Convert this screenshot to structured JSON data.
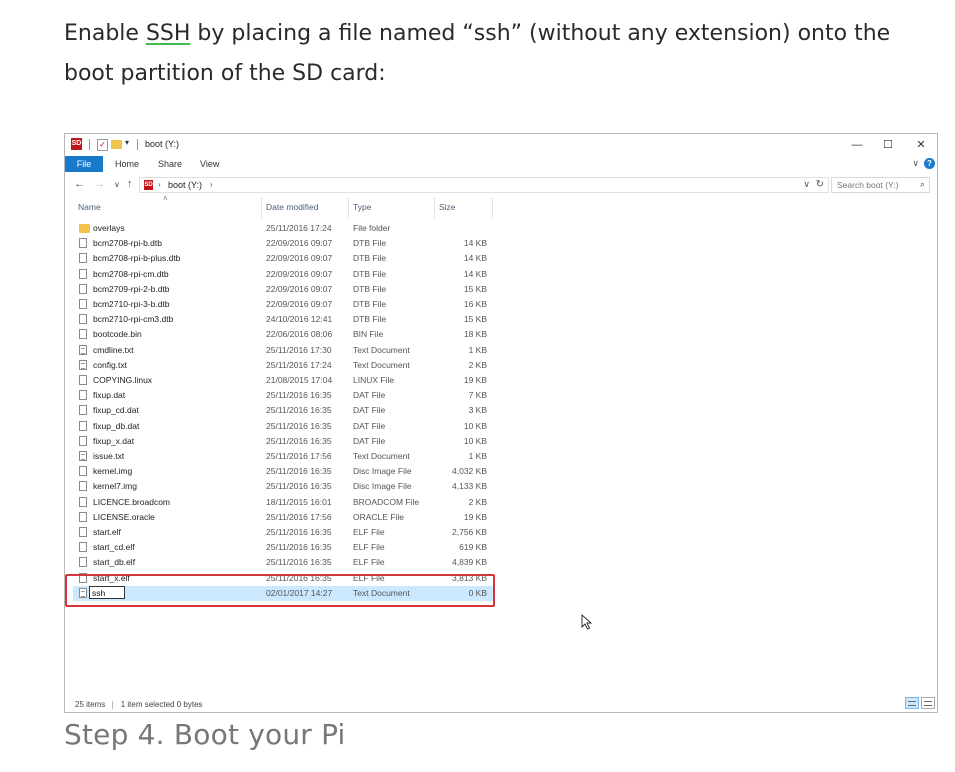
{
  "intro": {
    "before": "Enable ",
    "ssh_link": "SSH",
    "after": " by placing a file named “ssh” (without any extension) onto the boot partition of the SD card:"
  },
  "step_heading": "Step 4. Boot your Pi",
  "explorer": {
    "sd_logo": "SD",
    "quick_access_dropdown": "▾",
    "title": "boot (Y:)",
    "window_buttons": {
      "minimize": "—",
      "maximize": "☐",
      "close": "✕"
    },
    "ribbon": {
      "file": "File",
      "tabs": [
        "Home",
        "Share",
        "View"
      ],
      "help": "?",
      "expand": "∨"
    },
    "nav": {
      "back": "←",
      "forward": "→",
      "recent": "∨",
      "up": "↑"
    },
    "address": {
      "path": "boot (Y:)",
      "sep": "›",
      "dropdown": "∨",
      "refresh": "↻"
    },
    "search": {
      "placeholder": "Search boot (Y:)",
      "icon": "⌕"
    },
    "columns": {
      "name": "Name",
      "date": "Date modified",
      "type": "Type",
      "size": "Size",
      "sort": "˄"
    },
    "files": [
      {
        "name": "overlays",
        "date": "25/11/2016 17:24",
        "type": "File folder",
        "size": "",
        "icon": "folder-icon"
      },
      {
        "name": "bcm2708-rpi-b.dtb",
        "date": "22/09/2016 09:07",
        "type": "DTB File",
        "size": "14 KB",
        "icon": "file-icon"
      },
      {
        "name": "bcm2708-rpi-b-plus.dtb",
        "date": "22/09/2016 09:07",
        "type": "DTB File",
        "size": "14 KB",
        "icon": "file-icon"
      },
      {
        "name": "bcm2708-rpi-cm.dtb",
        "date": "22/09/2016 09:07",
        "type": "DTB File",
        "size": "14 KB",
        "icon": "file-icon"
      },
      {
        "name": "bcm2709-rpi-2-b.dtb",
        "date": "22/09/2016 09:07",
        "type": "DTB File",
        "size": "15 KB",
        "icon": "file-icon"
      },
      {
        "name": "bcm2710-rpi-3-b.dtb",
        "date": "22/09/2016 09:07",
        "type": "DTB File",
        "size": "16 KB",
        "icon": "file-icon"
      },
      {
        "name": "bcm2710-rpi-cm3.dtb",
        "date": "24/10/2016 12:41",
        "type": "DTB File",
        "size": "15 KB",
        "icon": "file-icon"
      },
      {
        "name": "bootcode.bin",
        "date": "22/06/2016 08:06",
        "type": "BIN File",
        "size": "18 KB",
        "icon": "file-icon"
      },
      {
        "name": "cmdline.txt",
        "date": "25/11/2016 17:30",
        "type": "Text Document",
        "size": "1 KB",
        "icon": "text-file-icon"
      },
      {
        "name": "config.txt",
        "date": "25/11/2016 17:24",
        "type": "Text Document",
        "size": "2 KB",
        "icon": "text-file-icon"
      },
      {
        "name": "COPYING.linux",
        "date": "21/08/2015 17:04",
        "type": "LINUX File",
        "size": "19 KB",
        "icon": "file-icon"
      },
      {
        "name": "fixup.dat",
        "date": "25/11/2016 16:35",
        "type": "DAT File",
        "size": "7 KB",
        "icon": "file-icon"
      },
      {
        "name": "fixup_cd.dat",
        "date": "25/11/2016 16:35",
        "type": "DAT File",
        "size": "3 KB",
        "icon": "file-icon"
      },
      {
        "name": "fixup_db.dat",
        "date": "25/11/2016 16:35",
        "type": "DAT File",
        "size": "10 KB",
        "icon": "file-icon"
      },
      {
        "name": "fixup_x.dat",
        "date": "25/11/2016 16:35",
        "type": "DAT File",
        "size": "10 KB",
        "icon": "file-icon"
      },
      {
        "name": "issue.txt",
        "date": "25/11/2016 17:56",
        "type": "Text Document",
        "size": "1 KB",
        "icon": "text-file-icon"
      },
      {
        "name": "kernel.img",
        "date": "25/11/2016 16:35",
        "type": "Disc Image File",
        "size": "4,032 KB",
        "icon": "disc-image-icon"
      },
      {
        "name": "kernel7.img",
        "date": "25/11/2016 16:35",
        "type": "Disc Image File",
        "size": "4,133 KB",
        "icon": "disc-image-icon"
      },
      {
        "name": "LICENCE.broadcom",
        "date": "18/11/2015 16:01",
        "type": "BROADCOM File",
        "size": "2 KB",
        "icon": "file-icon"
      },
      {
        "name": "LICENSE.oracle",
        "date": "25/11/2016 17:56",
        "type": "ORACLE File",
        "size": "19 KB",
        "icon": "file-icon"
      },
      {
        "name": "start.elf",
        "date": "25/11/2016 16:35",
        "type": "ELF File",
        "size": "2,756 KB",
        "icon": "file-icon"
      },
      {
        "name": "start_cd.elf",
        "date": "25/11/2016 16:35",
        "type": "ELF File",
        "size": "619 KB",
        "icon": "file-icon"
      },
      {
        "name": "start_db.elf",
        "date": "25/11/2016 16:35",
        "type": "ELF File",
        "size": "4,839 KB",
        "icon": "file-icon"
      },
      {
        "name": "start_x.elf",
        "date": "25/11/2016 16:35",
        "type": "ELF File",
        "size": "3,813 KB",
        "icon": "file-icon"
      },
      {
        "name": "ssh",
        "date": "02/01/2017 14:27",
        "type": "Text Document",
        "size": "0 KB",
        "icon": "text-file-icon",
        "selected": true,
        "renaming": true
      }
    ],
    "status": {
      "count": "25 items",
      "selection": "1 item selected  0 bytes"
    },
    "accent_color": "#1979ca",
    "highlight_color": "#d6353a",
    "selection_color": "#cce8ff"
  }
}
